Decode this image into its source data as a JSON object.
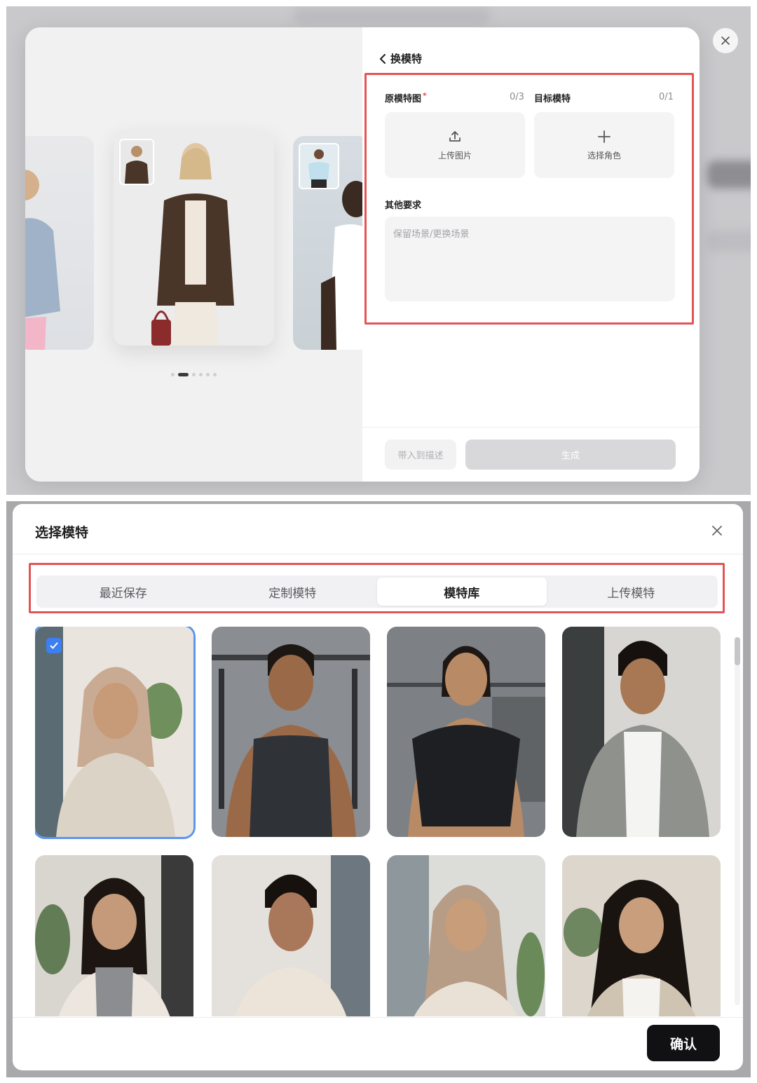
{
  "top_panel": {
    "back_title": "换模特",
    "original_label": "原模特图",
    "required_mark": "*",
    "original_count": "0/3",
    "target_label": "目标模特",
    "target_count": "0/1",
    "upload_label": "上传图片",
    "select_role_label": "选择角色",
    "other_label": "其他要求",
    "other_placeholder": "保留场景/更换场景",
    "fill_button": "带入到描述",
    "generate_button": "生成",
    "carousel_total": 6,
    "carousel_active_index": 1
  },
  "select_dialog": {
    "title": "选择模特",
    "tabs": [
      {
        "label": "最近保存",
        "active": false
      },
      {
        "label": "定制模特",
        "active": false
      },
      {
        "label": "模特库",
        "active": true
      },
      {
        "label": "上传模特",
        "active": false
      }
    ],
    "confirm_button": "确认",
    "models": [
      {
        "name": "model-hijab-older-woman",
        "selected": true
      },
      {
        "name": "model-man-tank-top-gym",
        "selected": false
      },
      {
        "name": "model-woman-black-tee-gym",
        "selected": false
      },
      {
        "name": "model-young-man-grey-shirt",
        "selected": false
      },
      {
        "name": "model-woman-turtleneck",
        "selected": false
      },
      {
        "name": "model-man-beige-shirt",
        "selected": false
      },
      {
        "name": "model-hijab-young-woman",
        "selected": false
      },
      {
        "name": "model-woman-curly-hair",
        "selected": false
      }
    ]
  },
  "colors": {
    "highlight": "#e35454",
    "selection_blue": "#3d7ff0",
    "confirm_bg": "#111113"
  }
}
